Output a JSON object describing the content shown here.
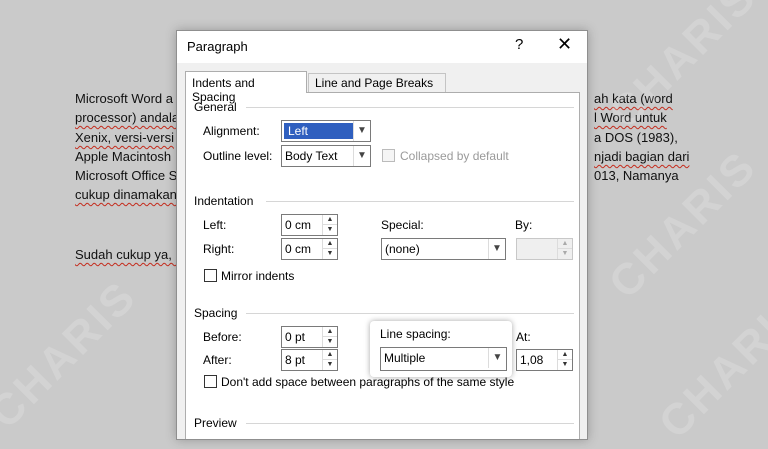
{
  "document": {
    "lines_left": [
      "Microsoft Word a",
      "processor) andala",
      "Xenix, versi-versi",
      "Apple Macintosh",
      "Microsoft Office S",
      "cukup dinamakan"
    ],
    "lines_right": [
      "ah kata (word",
      "l Word untuk",
      "a DOS (1983),",
      "njadi bagian dari",
      "013, Namanya"
    ],
    "line_after": "Sudah cukup ya, ("
  },
  "watermark": "CHARIS",
  "dialog": {
    "title": "Paragraph",
    "help_glyph": "?",
    "close_glyph": "✕",
    "tabs": [
      "Indents and Spacing",
      "Line and Page Breaks"
    ],
    "general": {
      "heading": "General",
      "alignment_label": "Alignment:",
      "alignment_value": "Left",
      "outline_label": "Outline level:",
      "outline_value": "Body Text",
      "collapsed_label": "Collapsed by default"
    },
    "indentation": {
      "heading": "Indentation",
      "left_label": "Left:",
      "left_value": "0 cm",
      "right_label": "Right:",
      "right_value": "0 cm",
      "special_label": "Special:",
      "special_value": "(none)",
      "by_label": "By:",
      "by_value": "",
      "mirror_label": "Mirror indents"
    },
    "spacing": {
      "heading": "Spacing",
      "before_label": "Before:",
      "before_value": "0 pt",
      "after_label": "After:",
      "after_value": "8 pt",
      "line_spacing_label": "Line spacing:",
      "line_spacing_value": "Multiple",
      "at_label": "At:",
      "at_value": "1,08",
      "dont_add_label": "Don't add space between paragraphs of the same style"
    },
    "preview": {
      "heading": "Preview"
    }
  }
}
